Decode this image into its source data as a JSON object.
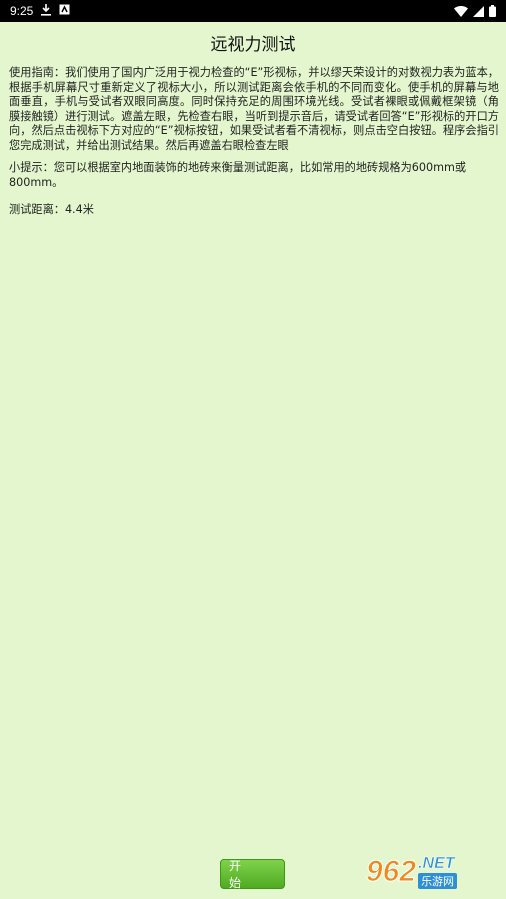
{
  "status_bar": {
    "time": "9:25",
    "icons": [
      "download-icon",
      "app-notification-icon",
      "wifi-icon",
      "signal-icon",
      "battery-icon"
    ]
  },
  "page": {
    "title": "远视力测试",
    "guide_text": "使用指南：我们使用了国内广泛用于视力检查的“E”形视标，并以缪天荣设计的对数视力表为蓝本，根据手机屏幕尺寸重新定义了视标大小，所以测试距离会依手机的不同而变化。使手机的屏幕与地面垂直，手机与受试者双眼同高度。同时保持充足的周围环境光线。受试者裸眼或佩戴框架镜（角膜接触镜）进行测试。遮盖左眼，先检查右眼，当听到提示音后，请受试者回答“E”形视标的开口方向，然后点击视标下方对应的“E”视标按钮，如果受试者看不清视标，则点击空白按钮。程序会指引您完成测试，并给出测试结果。然后再遮盖右眼检查左眼",
    "tip_text": "小提示：您可以根据室内地面装饰的地砖来衡量测试距离，比如常用的地砖规格为600mm或800mm。",
    "distance_text": "测试距离：4.4米",
    "start_button": "开 始"
  },
  "watermark": {
    "number": "962",
    "domain": ".NET",
    "brand": "乐游网"
  }
}
